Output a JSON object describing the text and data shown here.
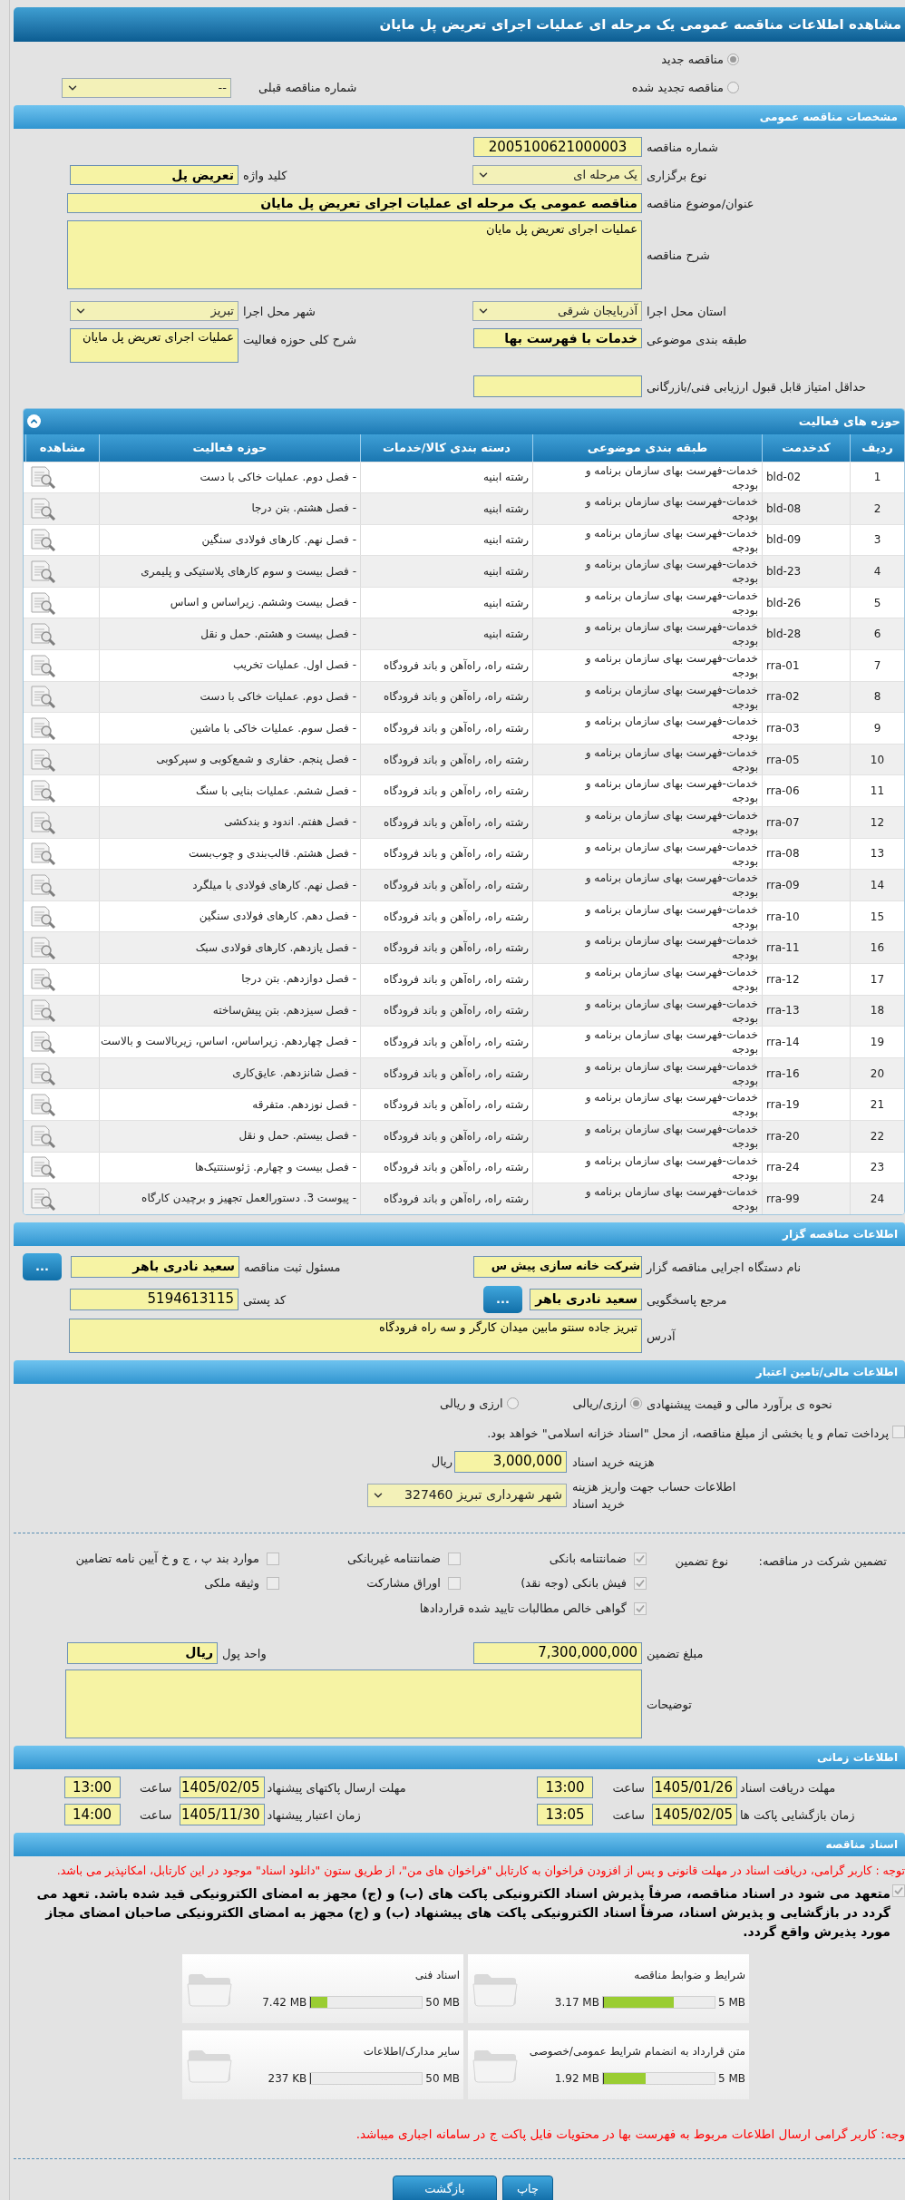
{
  "title": "مشاهده اطلاعات مناقصه عمومی یک مرحله ای عملیات اجرای تعریض پل مایان",
  "tender_type": [
    {
      "label": "مناقصه جدید",
      "selected": true
    },
    {
      "label": "مناقصه تجدید شده",
      "selected": false
    }
  ],
  "previous_tender": {
    "label": "شماره مناقصه قبلی",
    "value": "--"
  },
  "general": {
    "header": "مشخصات مناقصه عمومی",
    "tender_number": {
      "label": "شماره مناقصه",
      "value": "2005100621000003"
    },
    "holding_type": {
      "label": "نوع برگزاری",
      "value": "یک مرحله ای"
    },
    "keyword": {
      "label": "کلید واژه",
      "value": "تعریض پل"
    },
    "subject": {
      "label": "عنوان/موضوع مناقصه",
      "value": "مناقصه عمومی یک مرحله ای عملیات اجرای تعریض پل مایان"
    },
    "description": {
      "label": "شرح مناقصه",
      "value": "عملیات اجرای تعریض پل مایان"
    },
    "province": {
      "label": "استان محل اجرا",
      "value": "آذربایجان شرقی"
    },
    "city": {
      "label": "شهر محل اجرا",
      "value": "تبریز"
    },
    "classification": {
      "label": "طبقه بندی موضوعی",
      "value": "خدمات با فهرست بها"
    },
    "scope": {
      "label": "شرح کلی حوزه فعالیت",
      "value": "عملیات اجرای تعریض پل مایان"
    },
    "min_score": {
      "label": "حداقل امتیاز قابل قبول ارزیابی فنی/بازرگانی"
    }
  },
  "activities": {
    "header": "حوزه های فعالیت",
    "columns": [
      "ردیف",
      "کدخدمت",
      "طبقه بندی موضوعی",
      "دسته بندی کالا/خدمات",
      "حوزه فعالیت",
      "مشاهده"
    ],
    "rows": [
      {
        "index": "1",
        "code": "bld-02",
        "category": "خدمات-فهرست بهای سازمان برنامه و بودجه",
        "group": "رشته ابنیه",
        "activity": "- فصل دوم. عملیات خاکی با دست"
      },
      {
        "index": "2",
        "code": "bld-08",
        "category": "خدمات-فهرست بهای سازمان برنامه و بودجه",
        "group": "رشته ابنیه",
        "activity": "- فصل هشتم. بتن درجا"
      },
      {
        "index": "3",
        "code": "bld-09",
        "category": "خدمات-فهرست بهای سازمان برنامه و بودجه",
        "group": "رشته ابنیه",
        "activity": "- فصل نهم. کارهای فولادی سنگین"
      },
      {
        "index": "4",
        "code": "bld-23",
        "category": "خدمات-فهرست بهای سازمان برنامه و بودجه",
        "group": "رشته ابنیه",
        "activity": "- فصل بیست و سوم کارهای پلاستیکی و پلیمری"
      },
      {
        "index": "5",
        "code": "bld-26",
        "category": "خدمات-فهرست بهای سازمان برنامه و بودجه",
        "group": "رشته ابنیه",
        "activity": "- فصل بیست وششم. زیراساس و اساس"
      },
      {
        "index": "6",
        "code": "bld-28",
        "category": "خدمات-فهرست بهای سازمان برنامه و بودجه",
        "group": "رشته ابنیه",
        "activity": "- فصل بیست و هشتم. حمل و نقل"
      },
      {
        "index": "7",
        "code": "rra-01",
        "category": "خدمات-فهرست بهای سازمان برنامه و بودجه",
        "group": "رشته راه، راه‌آهن و باند فرودگاه",
        "activity": "- فصل اول. عملیات تخریب"
      },
      {
        "index": "8",
        "code": "rra-02",
        "category": "خدمات-فهرست بهای سازمان برنامه و بودجه",
        "group": "رشته راه، راه‌آهن و باند فرودگاه",
        "activity": "- فصل دوم. عملیات خاکی با دست"
      },
      {
        "index": "9",
        "code": "rra-03",
        "category": "خدمات-فهرست بهای سازمان برنامه و بودجه",
        "group": "رشته راه، راه‌آهن و باند فرودگاه",
        "activity": "- فصل سوم. عملیات خاکی با ماشین"
      },
      {
        "index": "10",
        "code": "rra-05",
        "category": "خدمات-فهرست بهای سازمان برنامه و بودجه",
        "group": "رشته راه، راه‌آهن و باند فرودگاه",
        "activity": "- فصل پنجم. حفاری و شمع‌کوبی و سپرکوبی"
      },
      {
        "index": "11",
        "code": "rra-06",
        "category": "خدمات-فهرست بهای سازمان برنامه و بودجه",
        "group": "رشته راه، راه‌آهن و باند فرودگاه",
        "activity": "- فصل ششم. عملیات بنایی با سنگ"
      },
      {
        "index": "12",
        "code": "rra-07",
        "category": "خدمات-فهرست بهای سازمان برنامه و بودجه",
        "group": "رشته راه، راه‌آهن و باند فرودگاه",
        "activity": "- فصل هفتم. اندود و بندکشی"
      },
      {
        "index": "13",
        "code": "rra-08",
        "category": "خدمات-فهرست بهای سازمان برنامه و بودجه",
        "group": "رشته راه، راه‌آهن و باند فرودگاه",
        "activity": "- فصل هشتم. قالب‌بندی و چوب‌بست"
      },
      {
        "index": "14",
        "code": "rra-09",
        "category": "خدمات-فهرست بهای سازمان برنامه و بودجه",
        "group": "رشته راه، راه‌آهن و باند فرودگاه",
        "activity": "- فصل نهم. کارهای فولادی با میلگرد"
      },
      {
        "index": "15",
        "code": "rra-10",
        "category": "خدمات-فهرست بهای سازمان برنامه و بودجه",
        "group": "رشته راه، راه‌آهن و باند فرودگاه",
        "activity": "- فصل دهم. کارهای فولادی سنگین"
      },
      {
        "index": "16",
        "code": "rra-11",
        "category": "خدمات-فهرست بهای سازمان برنامه و بودجه",
        "group": "رشته راه، راه‌آهن و باند فرودگاه",
        "activity": "- فصل یازدهم. کارهای فولادی سبک"
      },
      {
        "index": "17",
        "code": "rra-12",
        "category": "خدمات-فهرست بهای سازمان برنامه و بودجه",
        "group": "رشته راه، راه‌آهن و باند فرودگاه",
        "activity": "- فصل دوازدهم. بتن درجا"
      },
      {
        "index": "18",
        "code": "rra-13",
        "category": "خدمات-فهرست بهای سازمان برنامه و بودجه",
        "group": "رشته راه، راه‌آهن و باند فرودگاه",
        "activity": "- فصل سیزدهم. بتن پیش‌ساخته"
      },
      {
        "index": "19",
        "code": "rra-14",
        "category": "خدمات-فهرست بهای سازمان برنامه و بودجه",
        "group": "رشته راه، راه‌آهن و باند فرودگاه",
        "activity": "- فصل چهاردهم. زیراساس، اساس، زیربالاست و بالاست"
      },
      {
        "index": "20",
        "code": "rra-16",
        "category": "خدمات-فهرست بهای سازمان برنامه و بودجه",
        "group": "رشته راه، راه‌آهن و باند فرودگاه",
        "activity": "- فصل شانزدهم. عایق‌کاری"
      },
      {
        "index": "21",
        "code": "rra-19",
        "category": "خدمات-فهرست بهای سازمان برنامه و بودجه",
        "group": "رشته راه، راه‌آهن و باند فرودگاه",
        "activity": "- فصل نوزدهم. متفرقه"
      },
      {
        "index": "22",
        "code": "rra-20",
        "category": "خدمات-فهرست بهای سازمان برنامه و بودجه",
        "group": "رشته راه، راه‌آهن و باند فرودگاه",
        "activity": "- فصل بیستم. حمل و نقل"
      },
      {
        "index": "23",
        "code": "rra-24",
        "category": "خدمات-فهرست بهای سازمان برنامه و بودجه",
        "group": "رشته راه، راه‌آهن و باند فرودگاه",
        "activity": "- فصل بیست و چهارم. ژئوسنتتیک‌ها"
      },
      {
        "index": "24",
        "code": "rra-99",
        "category": "خدمات-فهرست بهای سازمان برنامه و بودجه",
        "group": "رشته راه، راه‌آهن و باند فرودگاه",
        "activity": "- پیوست 3. دستورالعمل تجهیز و برچیدن کارگاه"
      }
    ]
  },
  "organizer": {
    "header": "اطلاعات مناقصه گزار",
    "org_name": {
      "label": "نام دستگاه اجرایی مناقصه گزار",
      "value": "شرکت خانه سازی پیش س"
    },
    "registrar": {
      "label": "مسئول ثبت مناقصه",
      "value": "سعید نادری باهر",
      "button": "..."
    },
    "contact": {
      "label": "مرجع پاسخگویی",
      "value": "سعید نادری باهر",
      "button": "..."
    },
    "postal": {
      "label": "کد پستی",
      "value": "5194613115"
    },
    "address": {
      "label": "آدرس",
      "value": "تبریز جاده سنتو مابین میدان کارگر و سه راه فرودگاه"
    }
  },
  "finance": {
    "header": "اطلاعات مالی/تامین اعتبار",
    "estimate": {
      "label": "نحوه ی برآورد مالی و قیمت پیشنهادی",
      "options": [
        {
          "label": "ارزی/ریالی",
          "selected": true
        },
        {
          "label": "ارزی و ریالی",
          "selected": false
        }
      ]
    },
    "treasury": {
      "label": "پرداخت تمام و یا بخشی از مبلغ مناقصه، از محل \"اسناد خزانه اسلامی\" خواهد بود.",
      "checked": false
    },
    "doc_fee": {
      "label": "هزینه خرید اسناد",
      "value": "3,000,000",
      "unit": "ریال"
    },
    "account": {
      "label": "اطلاعات حساب جهت واریز هزینه خرید اسناد",
      "value": "شهر شهرداری تبریز 327460"
    },
    "guarantee": {
      "label": "تضمین شرکت در مناقصه:",
      "type_label": "نوع تضمین",
      "options": [
        {
          "label": "ضمانتنامه بانکی",
          "checked": true
        },
        {
          "label": "ضمانتنامه غیربانکی",
          "checked": false
        },
        {
          "label": "موارد بند پ ، ج و خ آیین نامه تضامین",
          "checked": false
        },
        {
          "label": "فیش بانکی (وجه نقد)",
          "checked": true
        },
        {
          "label": "اوراق مشارکت",
          "checked": false
        },
        {
          "label": "وثیقه ملکی",
          "checked": false
        },
        {
          "label": "گواهی خالص مطالبات تایید شده قراردادها",
          "checked": true
        }
      ]
    },
    "amount": {
      "label": "مبلغ تضمین",
      "value": "7,300,000,000"
    },
    "currency": {
      "label": "واحد پول",
      "value": "ریال"
    },
    "notes": {
      "label": "توضیحات"
    }
  },
  "timing": {
    "header": "اطلاعات زمانی",
    "items": [
      {
        "label": "مهلت دریافت اسناد",
        "date": "1405/01/26",
        "time_label": "ساعت",
        "time": "13:00"
      },
      {
        "label": "مهلت ارسال پاکتهای پیشنهاد",
        "date": "1405/02/05",
        "time_label": "ساعت",
        "time": "13:00"
      },
      {
        "label": "زمان بازگشایی پاکت ها",
        "date": "1405/02/05",
        "time_label": "ساعت",
        "time": "13:05"
      },
      {
        "label": "زمان اعتبار پیشنهاد",
        "date": "1405/11/30",
        "time_label": "ساعت",
        "time": "14:00"
      }
    ]
  },
  "documents": {
    "header": "اسناد مناقصه",
    "notice": "توجه : کاربر گرامی، دریافت اسناد در مهلت قانونی و پس از افزودن فراخوان به کارتابل \"فراخوان های من\"، از طریق ستون \"دانلود اسناد\" موجود در این کارتابل، امکانپذیر می باشد.",
    "commitment": {
      "text": "متعهد می شود در اسناد مناقصه، صرفاً پذیرش اسناد الکترونیکی پاکت های (ب) و (ج) مجهز به امضای الکترونیکی قید شده باشد. تعهد می گردد در بازگشایی و پذیرش اسناد، صرفاً اسناد الکترونیکی پاکت های پیشنهاد (ب) و (ج) مجهز به امضای الکترونیکی صاحبان امضای مجاز مورد پذیرش واقع گردد.",
      "checked": true
    },
    "files": [
      {
        "title": "شرایط و ضوابط مناقصه",
        "max": "5 MB",
        "size": "3.17 MB",
        "level": 0.634
      },
      {
        "title": "اسناد فنی",
        "max": "50 MB",
        "size": "7.42 MB",
        "level": 0.148
      },
      {
        "title": "متن قرارداد به انضمام شرایط عمومی/خصوصی",
        "max": "5 MB",
        "size": "1.92 MB",
        "level": 0.384
      },
      {
        "title": "سایر مدارک/اطلاعات",
        "max": "50 MB",
        "size": "237 KB",
        "level": 0.005
      }
    ],
    "note": "وجه: کاربر گرامی ارسال اطلاعات مربوط به فهرست بها در محتویات فایل پاکت ج در سامانه اجباری میباشد."
  },
  "buttons": [
    "چاپ",
    "بازگشت"
  ]
}
